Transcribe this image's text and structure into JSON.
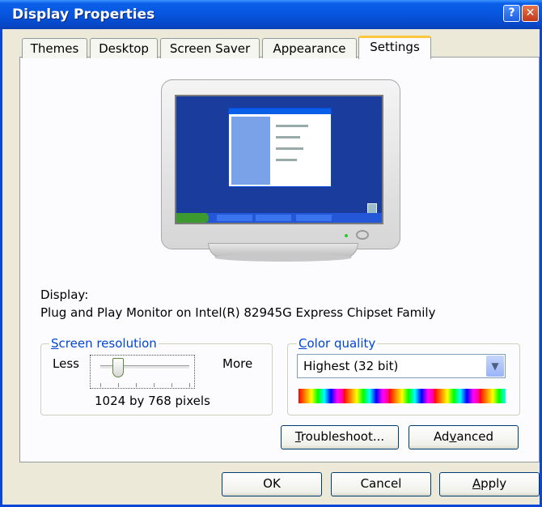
{
  "window": {
    "title": "Display Properties",
    "help_glyph": "?",
    "close_glyph": "✕"
  },
  "tabs": [
    {
      "label": "Themes"
    },
    {
      "label": "Desktop"
    },
    {
      "label": "Screen Saver"
    },
    {
      "label": "Appearance"
    },
    {
      "label": "Settings",
      "active": true
    }
  ],
  "display": {
    "label": "Display:",
    "device": "Plug and Play Monitor on Intel(R) 82945G Express Chipset Family"
  },
  "resolution": {
    "legend_first": "S",
    "legend_rest": "creen resolution",
    "less": "Less",
    "more": "More",
    "value": "1024 by 768 pixels",
    "slider_level": 0.2
  },
  "color_quality": {
    "legend_first": "C",
    "legend_rest": "olor quality",
    "selected": "Highest (32 bit)"
  },
  "buttons": {
    "troubleshoot_first": "T",
    "troubleshoot_rest": "roubleshoot...",
    "advanced_pre": "Ad",
    "advanced_u": "v",
    "advanced_post": "anced",
    "ok": "OK",
    "cancel": "Cancel",
    "apply_first": "A",
    "apply_rest": "pply"
  },
  "colors": {
    "title_blue": "#0a5fe8",
    "desktop_blue": "#1a3c9c",
    "active_tab_accent": "#ffc83c",
    "legend_blue": "#0046d5"
  }
}
